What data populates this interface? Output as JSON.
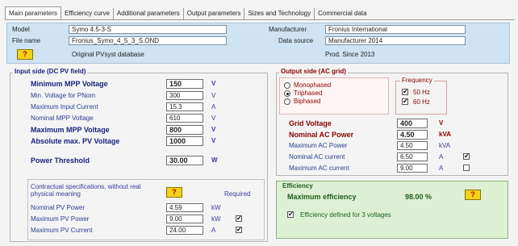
{
  "tabs": [
    "Main parameters",
    "Efficiency curve",
    "Additional parameters",
    "Output parameters",
    "Sizes and Technology",
    "Commercial data"
  ],
  "header": {
    "model_label": "Model",
    "model_value": "Symo 4.5-3-S",
    "filename_label": "File name",
    "filename_value": "Fronius_Symo_4_5_3_S.OND",
    "help_label": "?",
    "source_db": "Original PVsyst database",
    "manufacturer_label": "Manufacturer",
    "manufacturer_value": "Fronius International",
    "datasource_label": "Data source",
    "datasource_value": "Manufacturer 2014",
    "prod_since": "Prod. Since 2013"
  },
  "input_side": {
    "title": "Input side (DC PV field)",
    "rows": [
      {
        "label": "Minimum MPP Voltage",
        "value": "150",
        "unit": "V"
      },
      {
        "label": "Min. Voltage for PNom",
        "value": "300",
        "unit": "V"
      },
      {
        "label": "Maximum Input Current",
        "value": "15.3",
        "unit": "A"
      },
      {
        "label": "Nominal MPP Voltage",
        "value": "610",
        "unit": "V"
      },
      {
        "label": "Maximum MPP Voltage",
        "value": "800",
        "unit": "V"
      },
      {
        "label": "Absolute max. PV Voltage",
        "value": "1000",
        "unit": "V"
      },
      {
        "label": "Power Threshold",
        "value": "30.00",
        "unit": "W"
      }
    ],
    "contract_text": "Contractual specifications, without real physical meaning",
    "help_label": "?",
    "required_label": "Required",
    "contract_rows": [
      {
        "label": "Nominal PV Power",
        "value": "4.59",
        "unit": "kW"
      },
      {
        "label": "Maximum PV Power",
        "value": "9.00",
        "unit": "kW",
        "checked": "✔"
      },
      {
        "label": "Maximum PV Current",
        "value": "24.00",
        "unit": "A",
        "checked": "✔"
      }
    ]
  },
  "output_side": {
    "title": "Output side (AC grid)",
    "phase_options": [
      "Monophased",
      "Triphased",
      "Biphased"
    ],
    "phase_selected": "Triphased",
    "frequency_title": "Frequency",
    "freq_50": "50 Hz",
    "freq_60": "60 Hz",
    "freq_check": "✔",
    "rows": [
      {
        "label": "Grid Voltage",
        "value": "400",
        "unit": "V"
      },
      {
        "label": "Nominal AC Power",
        "value": "4.50",
        "unit": "kVA"
      },
      {
        "label": "Maximum AC Power",
        "value": "4.50",
        "unit": "kVA"
      },
      {
        "label": "Nominal AC current",
        "value": "6.50",
        "unit": "A"
      },
      {
        "label": "Maximum AC current",
        "value": "9.00",
        "unit": "A"
      }
    ],
    "nominal_current_check": "✔"
  },
  "efficiency": {
    "title": "Efficiency",
    "max_label": "Maximum efficiency",
    "max_value": "98.00 %",
    "help_label": "?",
    "check": "✔",
    "three_voltages_label": "Efficiency defined for 3 voltages"
  }
}
